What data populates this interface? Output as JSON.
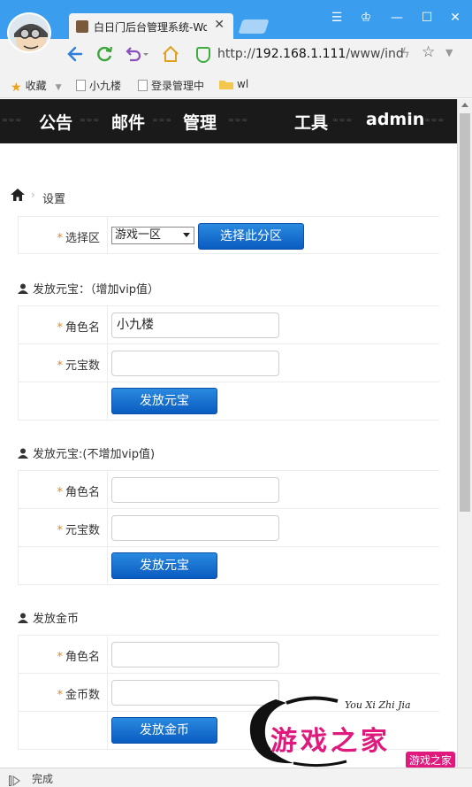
{
  "browser": {
    "tab_title": "白日门后台管理系统-Wo",
    "url_host": "192.168.1.111",
    "url_path": "/www/inde",
    "url_scheme": "http://",
    "bookmarks": [
      {
        "label": "收藏",
        "icon": "star-icon"
      },
      {
        "label": "小九楼",
        "icon": "page-icon"
      },
      {
        "label": "登录管理中",
        "icon": "page-icon"
      },
      {
        "label": "wl",
        "icon": "folder-icon"
      }
    ],
    "status_text": "完成"
  },
  "topnav": {
    "items": [
      "公告",
      "邮件",
      "管理",
      "工具",
      "admin"
    ]
  },
  "breadcrumb": {
    "current": "设置"
  },
  "zone": {
    "label": "选择区",
    "selected": "游戏一区",
    "button": "选择此分区"
  },
  "sections": [
    {
      "title": "发放元宝：（增加vip值）",
      "role_label": "角色名",
      "role_value": "小九楼",
      "amount_label": "元宝数",
      "amount_value": "",
      "button": "发放元宝"
    },
    {
      "title": "发放元宝:(不增加vip值)",
      "role_label": "角色名",
      "role_value": "",
      "amount_label": "元宝数",
      "amount_value": "",
      "button": "发放元宝"
    },
    {
      "title": "发放金币",
      "role_label": "角色名",
      "role_value": "",
      "amount_label": "金币数",
      "amount_value": "",
      "button": "发放金币"
    }
  ],
  "watermark": {
    "script": "You Xi Zhi Jia",
    "title": "游戏之家",
    "small": "游戏之家"
  },
  "colors": {
    "titlebar": "#3b9ded",
    "topnav_bg": "#1a1a1a",
    "button": "#0a5cc0",
    "required_star": "#e08a1e",
    "watermark": "#e0197d"
  }
}
